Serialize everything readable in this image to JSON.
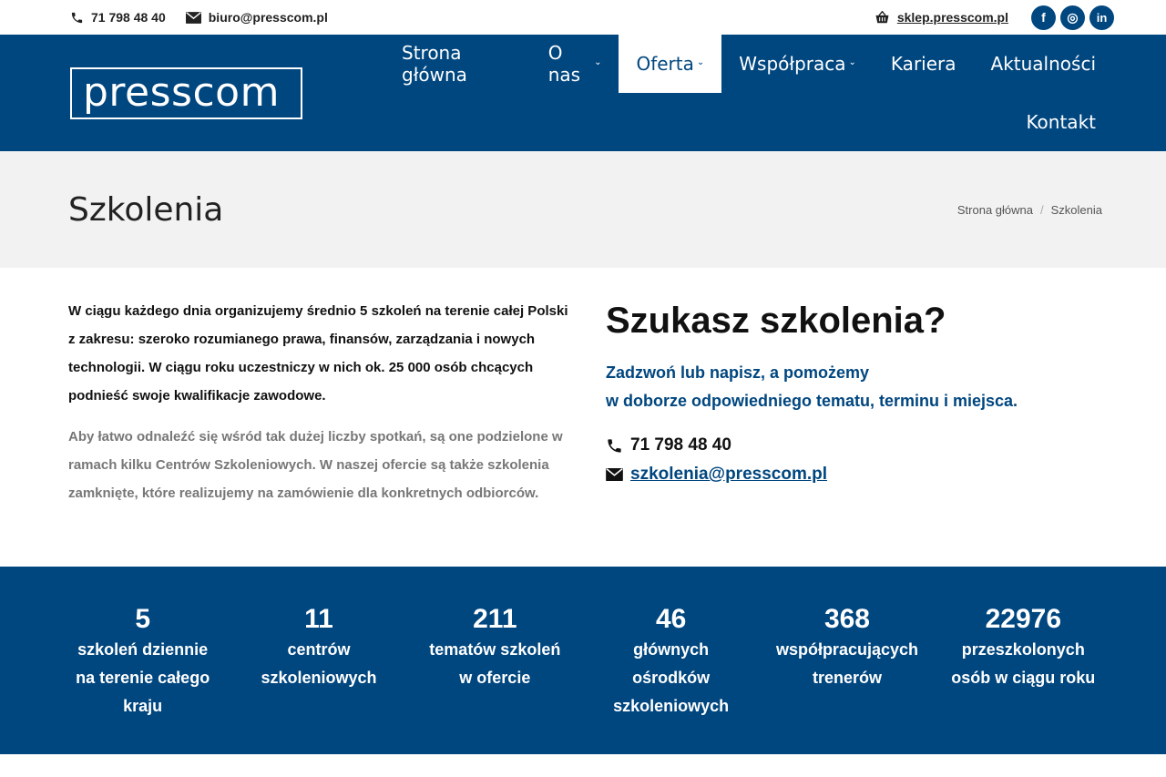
{
  "topbar": {
    "phone": "71 798 48 40",
    "email": "biuro@presscom.pl",
    "shop": "sklep.presscom.pl",
    "social": [
      "f",
      "◎",
      "in"
    ]
  },
  "header": {
    "logo": "presscom",
    "nav": [
      {
        "label": "Strona główna",
        "dropdown": false
      },
      {
        "label": "O nas",
        "dropdown": true
      },
      {
        "label": "Oferta",
        "dropdown": true,
        "active": true
      },
      {
        "label": "Współpraca",
        "dropdown": true
      },
      {
        "label": "Kariera",
        "dropdown": false
      },
      {
        "label": "Aktualności",
        "dropdown": false
      }
    ],
    "nav_row2": "Kontakt"
  },
  "titlebar": {
    "title": "Szkolenia",
    "breadcrumb": [
      "Strona główna",
      "Szkolenia"
    ],
    "separator": "/"
  },
  "content": {
    "lead": "W ciągu każdego dnia organizujemy średnio 5 szkoleń na terenie całej Polski z zakresu: szeroko rozumianego prawa, finansów, zarządzania i nowych technologii. W ciągu roku uczestniczy w nich ok. 25 000 osób chcących podnieść swoje kwalifikacje zawodowe.",
    "paragraph": "Aby łatwo odnaleźć się wśród tak dużej liczby spotkań, są one podzielone w ramach kilku Centrów Szkoleniowych. W naszej ofercie są także szkolenia zamknięte, które realizujemy na zamówienie dla konkretnych odbiorców.",
    "heading": "Szukasz szkolenia?",
    "subtitle_line1": "Zadzwoń lub napisz, a pomożemy",
    "subtitle_line2": "w doborze odpowiedniego tematu, terminu i miejsca.",
    "phone": "71 798 48 40",
    "email": "szkolenia@presscom.pl"
  },
  "stats": [
    {
      "num": "5",
      "label": "szkoleń dziennie\nna terenie całego\nkraju"
    },
    {
      "num": "11",
      "label": "centrów\nszkoleniowych"
    },
    {
      "num": "211",
      "label": "tematów szkoleń\nw ofercie"
    },
    {
      "num": "46",
      "label": "głównych\nośrodków\nszkoleniowych"
    },
    {
      "num": "368",
      "label": "współpracujących\ntrenerów"
    },
    {
      "num": "22976",
      "label": "przeszkolonych\nosób w ciągu roku"
    }
  ],
  "colors": {
    "brand": "#00467f",
    "band": "#f2f2f2"
  }
}
